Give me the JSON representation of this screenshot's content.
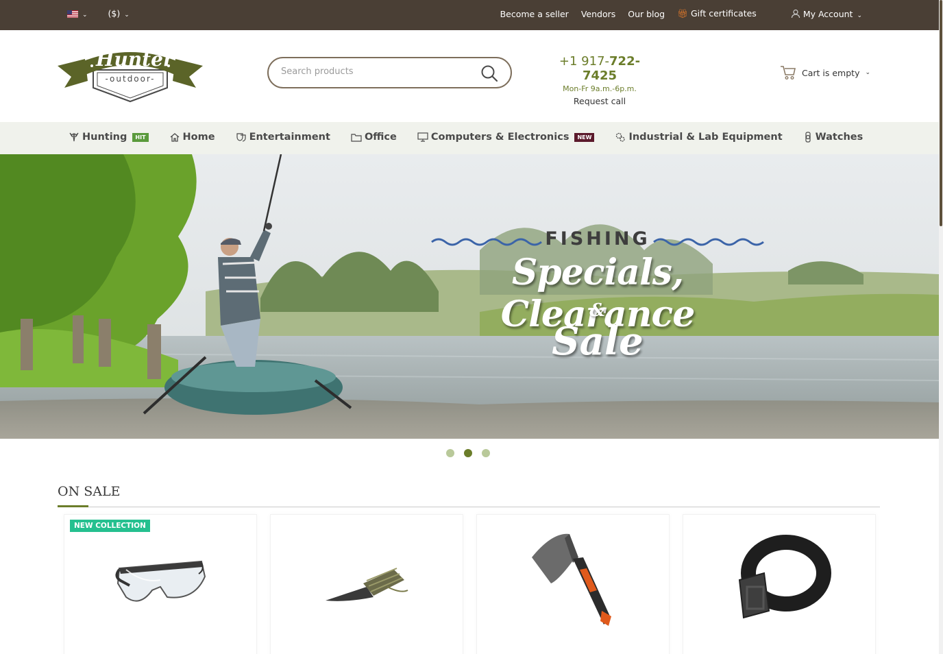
{
  "topbar": {
    "language_icon": "us-flag-icon",
    "currency": "($)",
    "links": [
      "Become a seller",
      "Vendors",
      "Our blog",
      "Gift certificates"
    ],
    "account": "My Account"
  },
  "header": {
    "logo_title": "Hunter",
    "logo_subtitle": "-outdoor-",
    "search_placeholder": "Search products",
    "phone_prefix": "+1 917-",
    "phone_bold": "722-7425",
    "hours": "Mon-Fr 9a.m.-6p.m.",
    "request_call": "Request call",
    "cart": "Cart is empty"
  },
  "menu": {
    "items": [
      {
        "label": "Hunting",
        "badge": "HIT",
        "icon": "deer-icon"
      },
      {
        "label": "Home",
        "icon": "home-icon"
      },
      {
        "label": "Entertainment",
        "icon": "theater-masks-icon"
      },
      {
        "label": "Office",
        "icon": "folder-icon"
      },
      {
        "label": "Computers & Electronics",
        "badge": "NEW",
        "icon": "monitor-icon"
      },
      {
        "label": "Industrial & Lab Equipment",
        "icon": "gears-icon"
      },
      {
        "label": "Watches",
        "icon": "watch-icon"
      }
    ]
  },
  "banner": {
    "eyebrow": "FISHING",
    "headline": "Specials, Clearance",
    "amp": "&",
    "sale": "Sale",
    "slides": 3,
    "active_slide": 2
  },
  "on_sale": {
    "title": "ON SALE",
    "products": [
      {
        "label": "NEW COLLECTION",
        "icon": "safety-glasses-image"
      },
      {
        "icon": "knife-image"
      },
      {
        "icon": "hatchet-image"
      },
      {
        "icon": "tactical-belt-image"
      }
    ]
  },
  "colors": {
    "topbar": "#4a3f35",
    "accent_green": "#6b7d2a",
    "menu_bg": "#f0f2ec",
    "label_teal": "#25c08f",
    "badge_new": "#5b1a2b",
    "badge_hit": "#5a9a3c"
  }
}
